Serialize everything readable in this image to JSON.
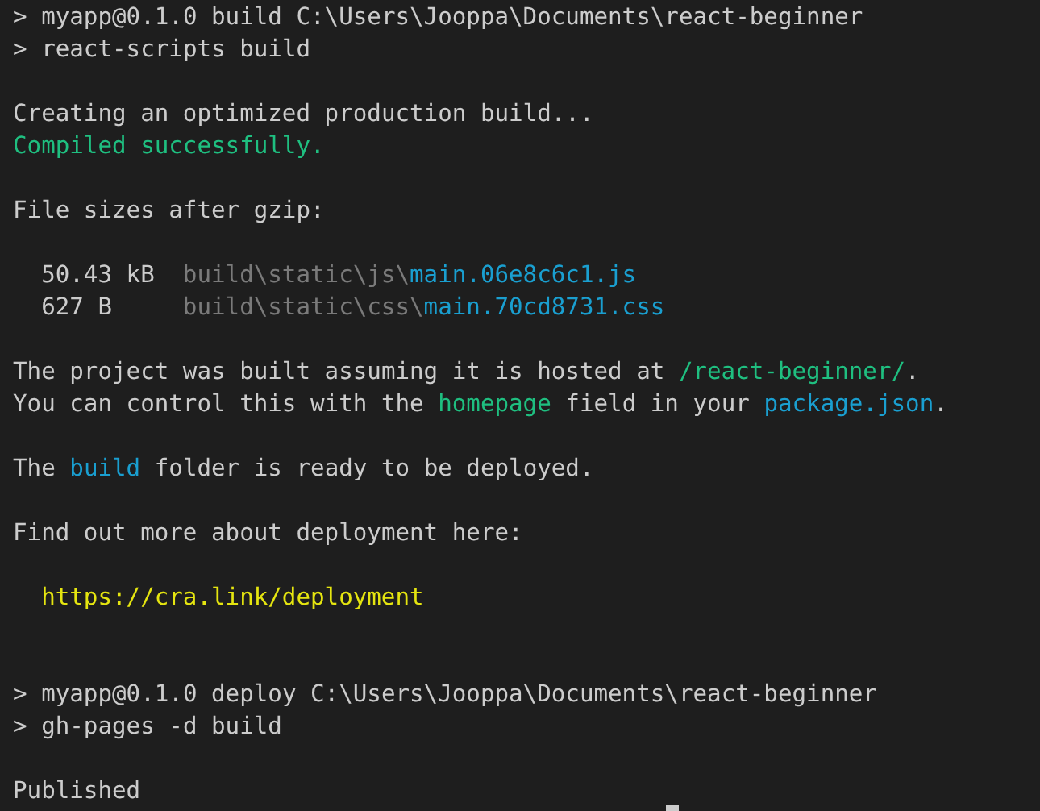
{
  "terminal": {
    "lines": [
      {
        "kind": "command",
        "prompt": ">",
        "text": "myapp@0.1.0 build C:\\Users\\Jooppa\\Documents\\react-beginner"
      },
      {
        "kind": "command",
        "prompt": ">",
        "text": "react-scripts build"
      },
      {
        "kind": "blank"
      },
      {
        "kind": "text",
        "segments": [
          {
            "text": "Creating an optimized production build...",
            "color": "#cccccc"
          }
        ]
      },
      {
        "kind": "text",
        "segments": [
          {
            "text": "Compiled successfully.",
            "color": "#1fbf80"
          }
        ]
      },
      {
        "kind": "blank"
      },
      {
        "kind": "text",
        "segments": [
          {
            "text": "File sizes after gzip:",
            "color": "#cccccc"
          }
        ]
      },
      {
        "kind": "blank"
      },
      {
        "kind": "file",
        "size": "50.43 kB",
        "dir": "build\\static\\js\\",
        "name": "main.06e8c6c1.js"
      },
      {
        "kind": "file",
        "size": "627 B",
        "dir": "build\\static\\css\\",
        "name": "main.70cd8731.css"
      },
      {
        "kind": "blank"
      },
      {
        "kind": "text",
        "segments": [
          {
            "text": "The project was built assuming it is hosted at ",
            "color": "#cccccc"
          },
          {
            "text": "/react-beginner/",
            "color": "#1fbf80"
          },
          {
            "text": ".",
            "color": "#cccccc"
          }
        ]
      },
      {
        "kind": "text",
        "segments": [
          {
            "text": "You can control this with the ",
            "color": "#cccccc"
          },
          {
            "text": "homepage",
            "color": "#1fbf80"
          },
          {
            "text": " field in your ",
            "color": "#cccccc"
          },
          {
            "text": "package.json",
            "color": "#1a9fd0"
          },
          {
            "text": ".",
            "color": "#cccccc"
          }
        ]
      },
      {
        "kind": "blank"
      },
      {
        "kind": "text",
        "segments": [
          {
            "text": "The ",
            "color": "#cccccc"
          },
          {
            "text": "build",
            "color": "#1a9fd0"
          },
          {
            "text": " folder is ready to be deployed.",
            "color": "#cccccc"
          }
        ]
      },
      {
        "kind": "blank"
      },
      {
        "kind": "text",
        "segments": [
          {
            "text": "Find out more about deployment here:",
            "color": "#cccccc"
          }
        ]
      },
      {
        "kind": "blank"
      },
      {
        "kind": "link",
        "url": "https://cra.link/deployment"
      },
      {
        "kind": "blank"
      },
      {
        "kind": "blank"
      },
      {
        "kind": "command",
        "prompt": ">",
        "text": "myapp@0.1.0 deploy C:\\Users\\Jooppa\\Documents\\react-beginner"
      },
      {
        "kind": "command",
        "prompt": ">",
        "text": "gh-pages -d build"
      },
      {
        "kind": "blank"
      },
      {
        "kind": "text",
        "segments": [
          {
            "text": "Published",
            "color": "#cccccc"
          }
        ]
      }
    ]
  }
}
